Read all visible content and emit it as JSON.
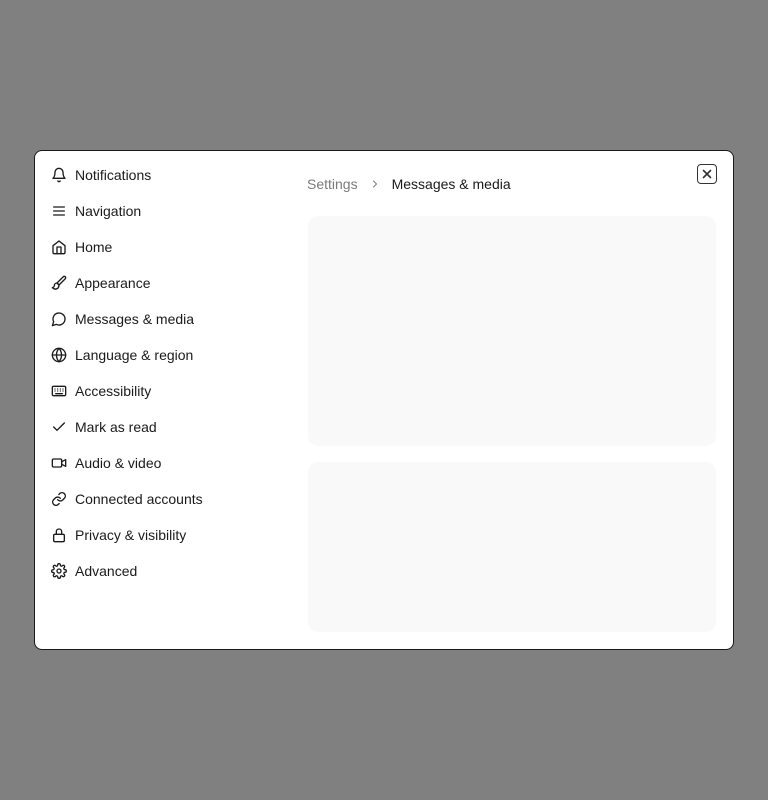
{
  "sidebar": {
    "items": [
      {
        "label": "Notifications",
        "icon": "bell-icon"
      },
      {
        "label": "Navigation",
        "icon": "menu-icon"
      },
      {
        "label": "Home",
        "icon": "home-icon"
      },
      {
        "label": "Appearance",
        "icon": "brush-icon"
      },
      {
        "label": "Messages & media",
        "icon": "message-circle-icon"
      },
      {
        "label": "Language & region",
        "icon": "globe-icon"
      },
      {
        "label": "Accessibility",
        "icon": "keyboard-icon"
      },
      {
        "label": "Mark as read",
        "icon": "check-icon"
      },
      {
        "label": "Audio & video",
        "icon": "video-icon"
      },
      {
        "label": "Connected accounts",
        "icon": "link-icon"
      },
      {
        "label": "Privacy & visibility",
        "icon": "lock-icon"
      },
      {
        "label": "Advanced",
        "icon": "gear-icon"
      }
    ]
  },
  "breadcrumb": {
    "root": "Settings",
    "current": "Messages & media"
  },
  "colors": {
    "overlay": "#808080",
    "panel": "#f9f9f9",
    "muted_text": "#7a7a7a"
  }
}
